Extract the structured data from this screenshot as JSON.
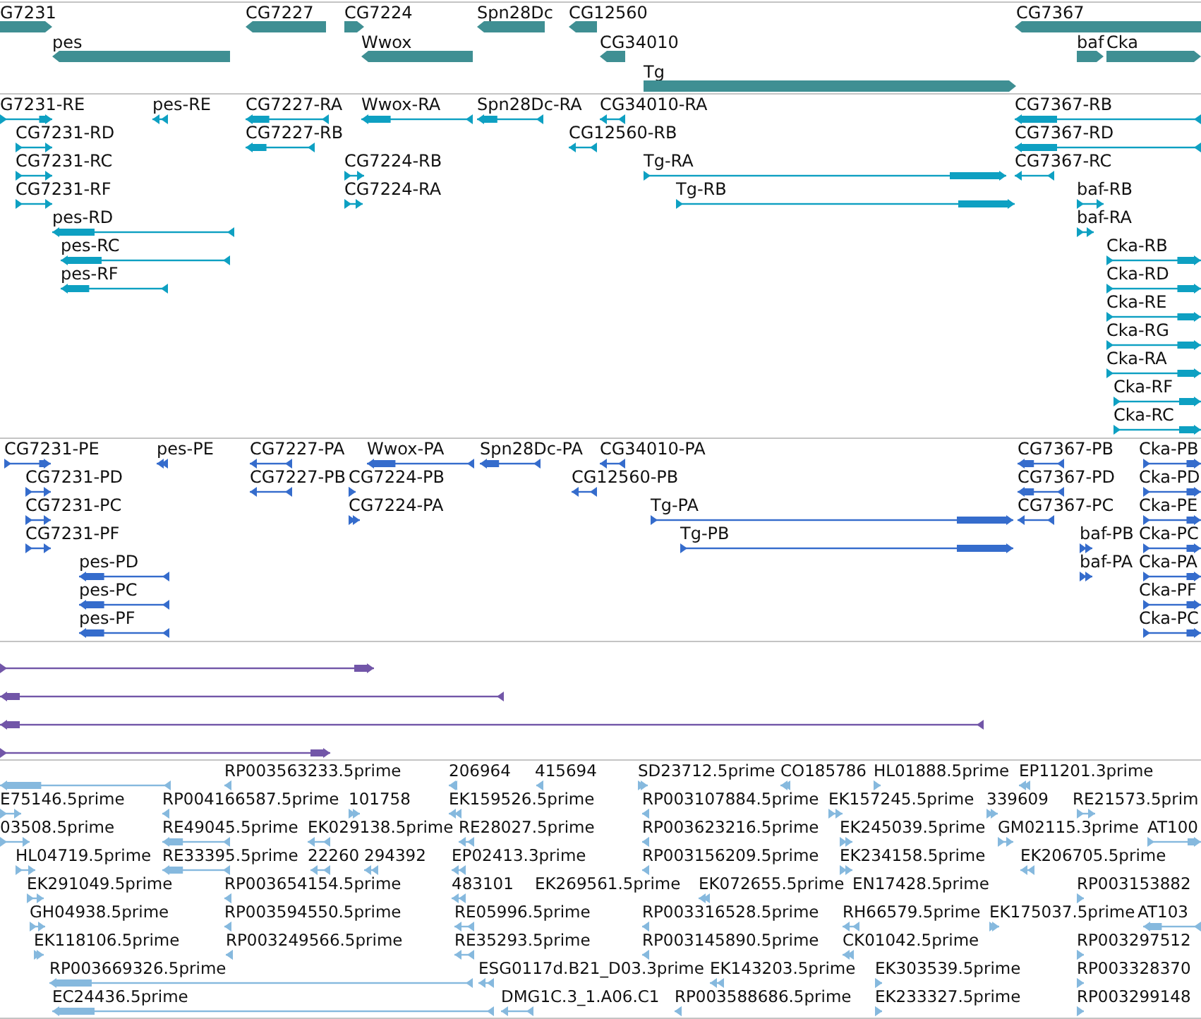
{
  "tracks": [
    {
      "kind": "gene",
      "features": [
        {
          "label": "G7231",
          "reverse": false
        },
        {
          "label": "CG7227",
          "reverse": true
        },
        {
          "label": "CG7224",
          "reverse": false
        },
        {
          "label": "Spn28Dc",
          "reverse": true
        },
        {
          "label": "CG12560",
          "reverse": true
        },
        {
          "label": "CG7367",
          "reverse": true
        },
        {
          "label": "pes",
          "reverse": true
        },
        {
          "label": "Wwox",
          "reverse": true
        },
        {
          "label": "CG34010",
          "reverse": true
        },
        {
          "label": "baf",
          "reverse": false
        },
        {
          "label": "Cka",
          "reverse": false
        },
        {
          "label": "Tg",
          "reverse": false
        }
      ]
    },
    {
      "kind": "transcript",
      "features": [
        {
          "label": "G7231-RE",
          "reverse": false
        },
        {
          "label": "pes-RE",
          "reverse": true
        },
        {
          "label": "CG7227-RA",
          "reverse": true
        },
        {
          "label": "Wwox-RA",
          "reverse": true
        },
        {
          "label": "Spn28Dc-RA",
          "reverse": true
        },
        {
          "label": "CG34010-RA",
          "reverse": true
        },
        {
          "label": "CG7367-RB",
          "reverse": true
        },
        {
          "label": "CG7231-RD",
          "reverse": false
        },
        {
          "label": "CG7227-RB",
          "reverse": true
        },
        {
          "label": "CG12560-RB",
          "reverse": true
        },
        {
          "label": "CG7367-RD",
          "reverse": true
        },
        {
          "label": "CG7231-RC",
          "reverse": false
        },
        {
          "label": "CG7224-RB",
          "reverse": false
        },
        {
          "label": "Tg-RA",
          "reverse": false
        },
        {
          "label": "CG7367-RC",
          "reverse": true
        },
        {
          "label": "CG7231-RF",
          "reverse": false
        },
        {
          "label": "CG7224-RA",
          "reverse": false
        },
        {
          "label": "Tg-RB",
          "reverse": false
        },
        {
          "label": "baf-RB",
          "reverse": false
        },
        {
          "label": "pes-RD",
          "reverse": true
        },
        {
          "label": "baf-RA",
          "reverse": false
        },
        {
          "label": "pes-RC",
          "reverse": true
        },
        {
          "label": "Cka-RB",
          "reverse": false
        },
        {
          "label": "pes-RF",
          "reverse": true
        },
        {
          "label": "Cka-RD",
          "reverse": false
        },
        {
          "label": "Cka-RE",
          "reverse": false
        },
        {
          "label": "Cka-RG",
          "reverse": false
        },
        {
          "label": "Cka-RA",
          "reverse": false
        },
        {
          "label": "Cka-RF",
          "reverse": false
        },
        {
          "label": "Cka-RC",
          "reverse": false
        }
      ]
    },
    {
      "kind": "protein",
      "features": [
        {
          "label": "CG7231-PE",
          "reverse": false
        },
        {
          "label": "pes-PE",
          "reverse": true
        },
        {
          "label": "CG7227-PA",
          "reverse": true
        },
        {
          "label": "Wwox-PA",
          "reverse": true
        },
        {
          "label": "Spn28Dc-PA",
          "reverse": true
        },
        {
          "label": "CG34010-PA",
          "reverse": true
        },
        {
          "label": "CG7367-PB",
          "reverse": true
        },
        {
          "label": "Cka-PB",
          "reverse": false
        },
        {
          "label": "CG7231-PD",
          "reverse": false
        },
        {
          "label": "CG7227-PB",
          "reverse": true
        },
        {
          "label": "CG7224-PB",
          "reverse": false
        },
        {
          "label": "CG12560-PB",
          "reverse": true
        },
        {
          "label": "CG7367-PD",
          "reverse": true
        },
        {
          "label": "Cka-PD",
          "reverse": false
        },
        {
          "label": "CG7231-PC",
          "reverse": false
        },
        {
          "label": "CG7224-PA",
          "reverse": false
        },
        {
          "label": "Tg-PA",
          "reverse": false
        },
        {
          "label": "CG7367-PC",
          "reverse": true
        },
        {
          "label": "Cka-PE",
          "reverse": false
        },
        {
          "label": "CG7231-PF",
          "reverse": false
        },
        {
          "label": "Tg-PB",
          "reverse": false
        },
        {
          "label": "baf-PB",
          "reverse": false
        },
        {
          "label": "Cka-PC",
          "reverse": false
        },
        {
          "label": "pes-PD",
          "reverse": true
        },
        {
          "label": "baf-PA",
          "reverse": false
        },
        {
          "label": "Cka-PA",
          "reverse": false
        },
        {
          "label": "pes-PC",
          "reverse": true
        },
        {
          "label": "Cka-PF",
          "reverse": false
        },
        {
          "label": "pes-PF",
          "reverse": true
        },
        {
          "label": "Cka-PC",
          "reverse": false
        }
      ]
    },
    {
      "kind": "alignment",
      "features": [
        {
          "reverse": false
        },
        {
          "reverse": true
        },
        {
          "reverse": true
        },
        {
          "reverse": false
        }
      ]
    },
    {
      "kind": "est",
      "features": [
        {
          "reverse": true
        },
        {
          "label": "RP003563233.5prime",
          "reverse": true
        },
        {
          "label": "206964",
          "reverse": true
        },
        {
          "label": "415694",
          "reverse": true
        },
        {
          "label": "SD23712.5prime",
          "reverse": false
        },
        {
          "label": "CO185786",
          "reverse": true
        },
        {
          "label": "HL01888.5prime",
          "reverse": false
        },
        {
          "label": "EP11201.3prime",
          "reverse": true
        },
        {
          "label": "E75146.5prime",
          "reverse": false
        },
        {
          "label": "RP004166587.5prime",
          "reverse": true
        },
        {
          "label": "101758",
          "reverse": false
        },
        {
          "label": "EK159526.5prime",
          "reverse": true
        },
        {
          "label": "RP003107884.5prime",
          "reverse": true
        },
        {
          "label": "EK157245.5prime",
          "reverse": false
        },
        {
          "label": "339609",
          "reverse": false
        },
        {
          "label": "RE21573.5prim",
          "reverse": false
        },
        {
          "label": "03508.5prime",
          "reverse": false
        },
        {
          "label": "RE49045.5prime",
          "reverse": true
        },
        {
          "label": "EK029138.5prime",
          "reverse": true
        },
        {
          "label": "RE28027.5prime",
          "reverse": true
        },
        {
          "label": "RP003623216.5prime",
          "reverse": true
        },
        {
          "label": "EK245039.5prime",
          "reverse": false
        },
        {
          "label": "GM02115.3prime",
          "reverse": false
        },
        {
          "label": "AT100",
          "reverse": false
        },
        {
          "label": "HL04719.5prime",
          "reverse": false
        },
        {
          "label": "RE33395.5prime",
          "reverse": true
        },
        {
          "label": "22260",
          "reverse": true
        },
        {
          "label": "294392",
          "reverse": true
        },
        {
          "label": "EP02413.3prime",
          "reverse": true
        },
        {
          "label": "RP003156209.5prime",
          "reverse": true
        },
        {
          "label": "EK234158.5prime",
          "reverse": false
        },
        {
          "label": "EK206705.5prime",
          "reverse": true
        },
        {
          "label": "EK291049.5prime",
          "reverse": false
        },
        {
          "label": "RP003654154.5prime",
          "reverse": true
        },
        {
          "label": "483101",
          "reverse": true
        },
        {
          "label": "EK269561.5prime"
        },
        {
          "label": "EK072655.5prime",
          "reverse": true
        },
        {
          "label": "EN17428.5prime"
        },
        {
          "label": "RP003153882",
          "reverse": false
        },
        {
          "label": "GH04938.5prime",
          "reverse": false
        },
        {
          "label": "RP003594550.5prime",
          "reverse": true
        },
        {
          "label": "RE05996.5prime",
          "reverse": true
        },
        {
          "label": "RP003316528.5prime",
          "reverse": true
        },
        {
          "label": "RH66579.5prime",
          "reverse": true
        },
        {
          "label": "EK175037.5prime",
          "reverse": false
        },
        {
          "label": "AT103",
          "reverse": true
        },
        {
          "label": "EK118106.5prime",
          "reverse": false
        },
        {
          "label": "RP003249566.5prime",
          "reverse": true
        },
        {
          "label": "RE35293.5prime",
          "reverse": true
        },
        {
          "label": "RP003145890.5prime",
          "reverse": true
        },
        {
          "label": "CK01042.5prime",
          "reverse": true
        },
        {
          "label": "RP003297512",
          "reverse": false
        },
        {
          "label": "RP003669326.5prime",
          "reverse": true
        },
        {
          "label": "ESG0117d.B21_D03.3prime",
          "reverse": true
        },
        {
          "label": "EK143203.5prime",
          "reverse": true
        },
        {
          "label": "EK303539.5prime",
          "reverse": false
        },
        {
          "label": "RP003328370",
          "reverse": false
        },
        {
          "label": "EC24436.5prime",
          "reverse": true
        },
        {
          "label": "DMG1C.3_1.A06.C1",
          "reverse": true
        },
        {
          "label": "RP003588686.5prime",
          "reverse": true
        },
        {
          "label": "EK233327.5prime",
          "reverse": false
        },
        {
          "label": "RP003299148",
          "reverse": false
        }
      ]
    }
  ]
}
